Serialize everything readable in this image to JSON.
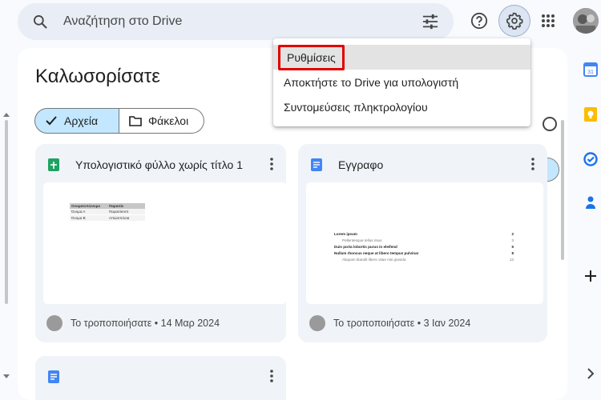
{
  "search": {
    "placeholder": "Αναζήτηση στο Drive"
  },
  "main": {
    "welcome": "Καλωσορίσατε",
    "toggle": {
      "files_label": "Αρχεία",
      "folders_label": "Φάκελοι"
    }
  },
  "cards": [
    {
      "title": "Υπολογιστικό φύλλο χωρίς τίτλο 1",
      "type_icon": "sheets-icon",
      "modified": "Το τροποποιήσατε • 14 Μαρ 2024",
      "sheet": {
        "header": [
          "Ονοματεπώνυμο",
          "Παραιτίε"
        ],
        "rows": [
          [
            "Όνομα Α",
            "Παραιτίκτσπ"
          ],
          [
            "Όνομα Β",
            "Απώσιπόσια"
          ]
        ]
      }
    },
    {
      "title": "Εγγραφο",
      "type_icon": "docs-icon",
      "modified": "Το τροποποιήσατε • 3 Ιαν 2024",
      "doc_lines": [
        {
          "text": "Lorem ipsum",
          "num": "2",
          "style": "b"
        },
        {
          "text": "Pellentesque tellus risus",
          "num": "3",
          "style": "sub"
        },
        {
          "text": "Duis porta lobortis purus in eleifend",
          "num": "5",
          "style": "b"
        },
        {
          "text": "Nullam rhoncus neque at libero tempus pulvinar",
          "num": "8",
          "style": "b"
        },
        {
          "text": "Aliquam blandit libero vitae nisi gravida",
          "num": "13",
          "style": "sub"
        }
      ]
    },
    {
      "title": "",
      "type_icon": "docs-icon"
    }
  ],
  "menu": {
    "items": [
      {
        "label": "Ρυθμίσεις"
      },
      {
        "label": "Αποκτήστε το Drive για υπολογιστή"
      },
      {
        "label": "Συντομεύσεις πληκτρολογίου"
      }
    ]
  },
  "colors": {
    "accent_selected": "#c2e7ff",
    "highlight_border": "#e00000",
    "page_bg": "#f8fafd"
  }
}
